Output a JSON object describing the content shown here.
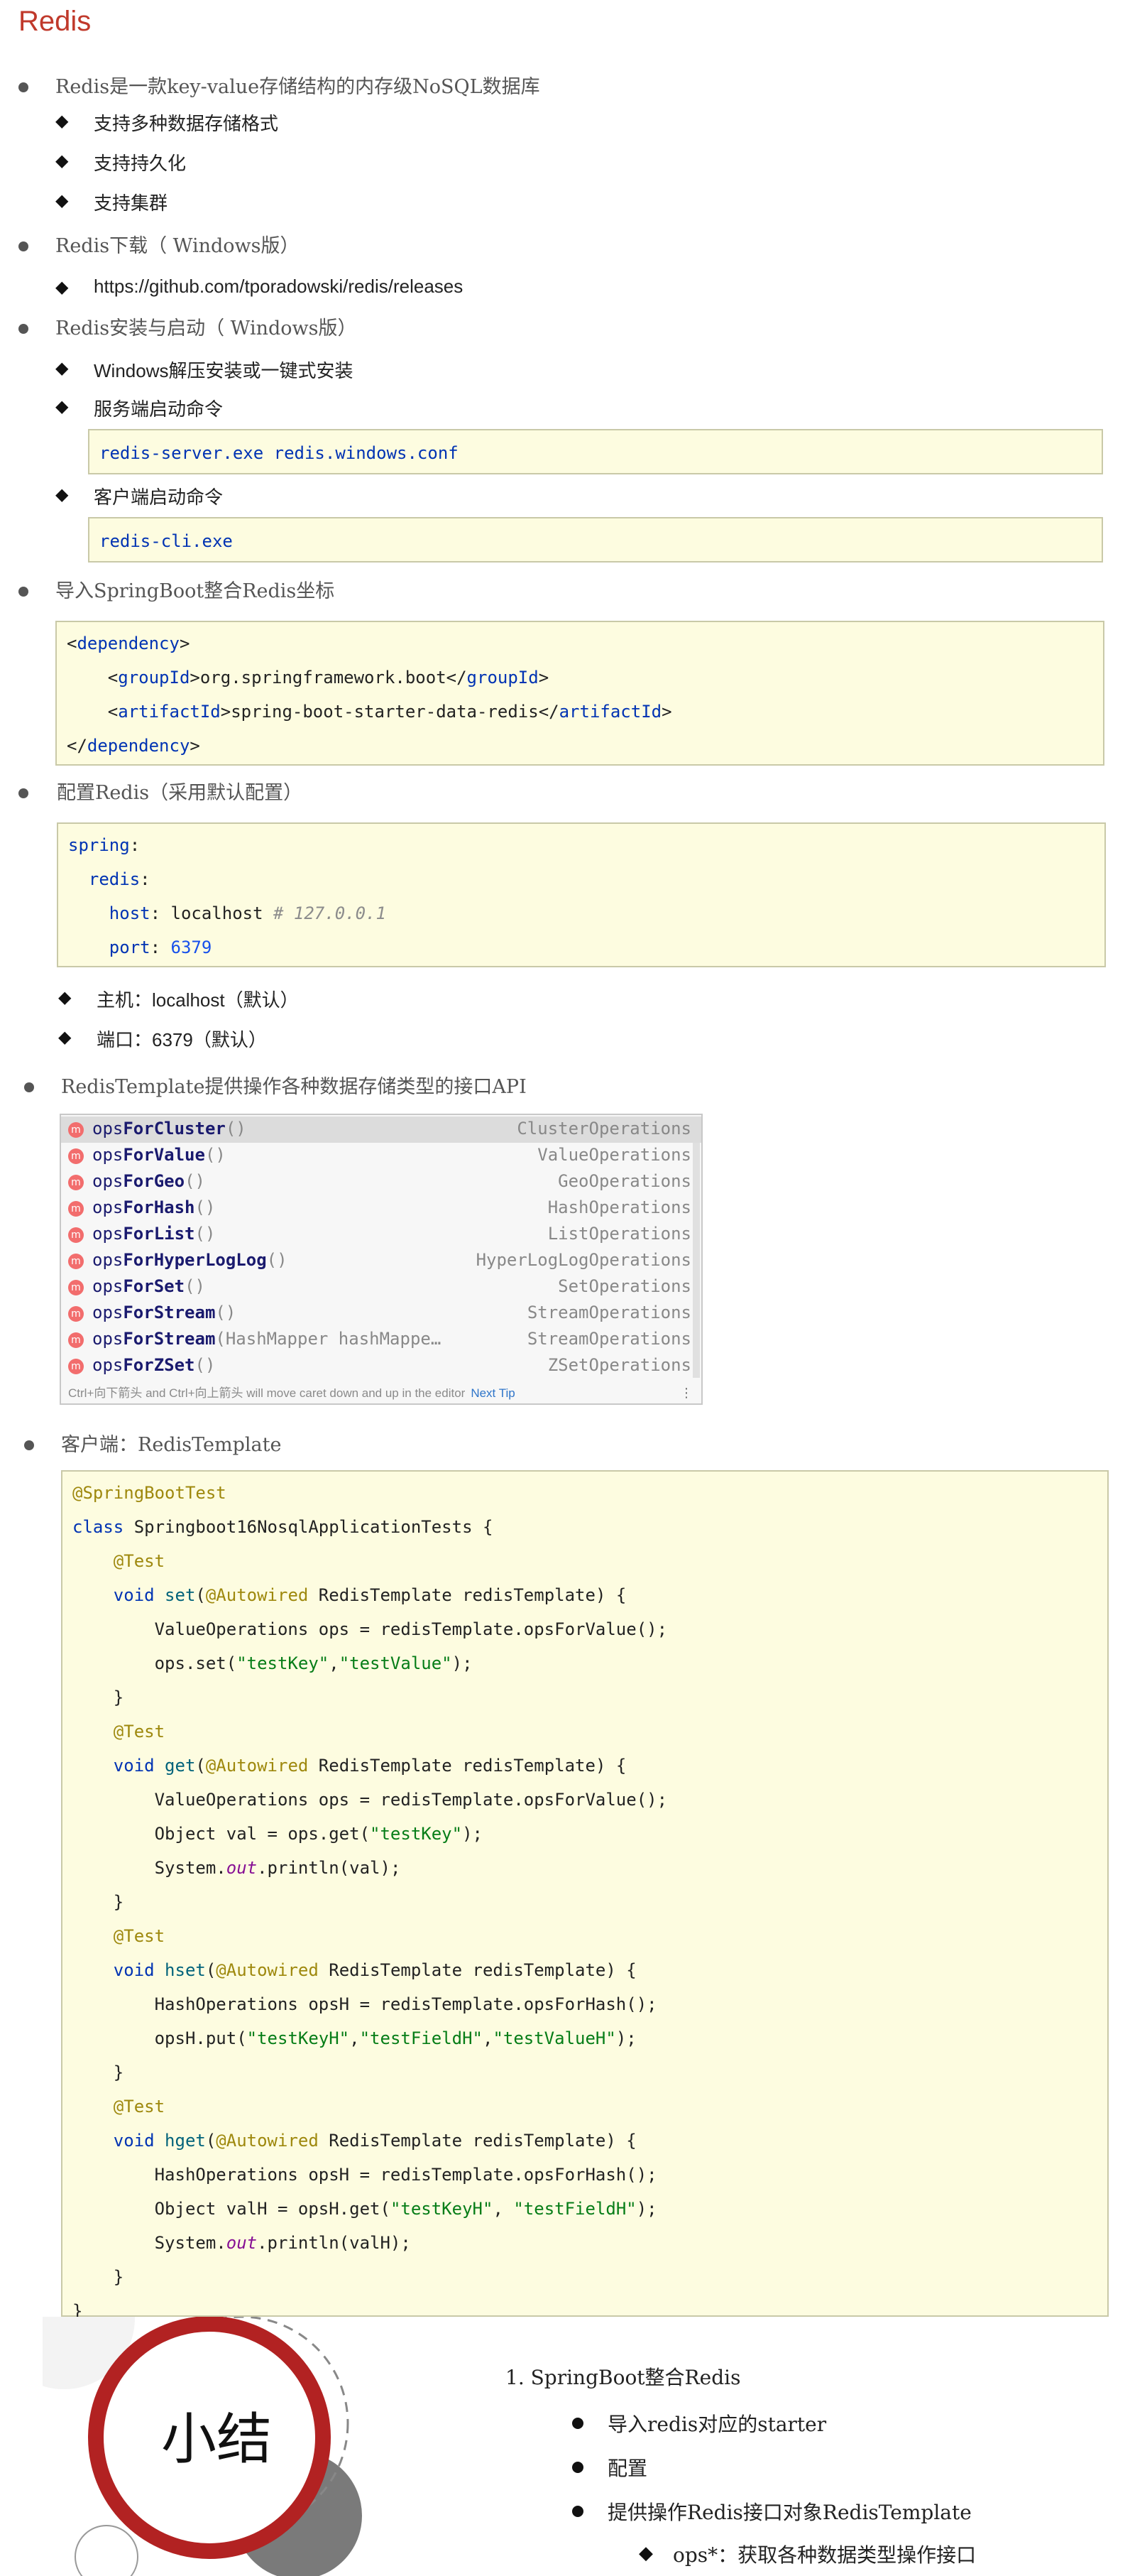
{
  "title": "Redis",
  "sections": {
    "intro": {
      "heading": "Redis是一款key-value存储结构的内存级NoSQL数据库",
      "items": [
        "支持多种数据存储格式",
        "支持持久化",
        "支持集群"
      ]
    },
    "download": {
      "heading": "Redis下载（ Windows版）",
      "items": [
        "https://github.com/tporadowski/redis/releases"
      ]
    },
    "install": {
      "heading": "Redis安装与启动（ Windows版）",
      "items": [
        "Windows解压安装或一键式安装",
        "服务端启动命令",
        "客户端启动命令"
      ],
      "server_cmd": "redis-server.exe redis.windows.conf",
      "client_cmd": "redis-cli.exe"
    },
    "dependency": {
      "heading": "导入SpringBoot整合Redis坐标",
      "group_id": "org.springframework.boot",
      "artifact_id": "spring-boot-starter-data-redis",
      "tag_dependency": "dependency",
      "tag_group": "groupId",
      "tag_artifact": "artifactId"
    },
    "config": {
      "heading": "配置Redis（采用默认配置）",
      "yaml_spring": "spring",
      "yaml_redis": "redis",
      "yaml_host_key": "host",
      "yaml_host_val": "localhost",
      "yaml_host_comment": "# 127.0.0.1",
      "yaml_port_key": "port",
      "yaml_port_val": "6379",
      "items": [
        "主机：localhost（默认）",
        "端口：6379（默认）"
      ]
    },
    "api": {
      "heading": "RedisTemplate提供操作各种数据存储类型的接口API",
      "completions": [
        {
          "pre": "ops",
          "bold": "ForCluster",
          "params": "()",
          "type": "ClusterOperations"
        },
        {
          "pre": "ops",
          "bold": "ForValue",
          "params": "()",
          "type": "ValueOperations"
        },
        {
          "pre": "ops",
          "bold": "ForGeo",
          "params": "()",
          "type": "GeoOperations"
        },
        {
          "pre": "ops",
          "bold": "ForHash",
          "params": "()",
          "type": "HashOperations"
        },
        {
          "pre": "ops",
          "bold": "ForList",
          "params": "()",
          "type": "ListOperations"
        },
        {
          "pre": "ops",
          "bold": "ForHyperLogLog",
          "params": "()",
          "type": "HyperLogLogOperations"
        },
        {
          "pre": "ops",
          "bold": "ForSet",
          "params": "()",
          "type": "SetOperations"
        },
        {
          "pre": "ops",
          "bold": "ForStream",
          "params": "()",
          "type": "StreamOperations"
        },
        {
          "pre": "ops",
          "bold": "ForStream",
          "params": "(HashMapper hashMappe…",
          "type": "StreamOperations"
        },
        {
          "pre": "ops",
          "bold": "ForZSet",
          "params": "()",
          "type": "ZSetOperations"
        }
      ],
      "footer_hint": "Ctrl+向下箭头 and Ctrl+向上箭头 will move caret down and up in the editor",
      "footer_link": "Next Tip",
      "method_icon": "m"
    },
    "client": {
      "heading": "客户端：RedisTemplate"
    }
  },
  "summary": {
    "badge": "小结",
    "title": "1. SpringBoot整合Redis",
    "items": [
      "导入redis对应的starter",
      "配置",
      "提供操作Redis接口对象RedisTemplate"
    ],
    "subitem": "ops*：获取各种数据类型操作接口",
    "ring_color": "#b22222"
  },
  "colors": {
    "title": "#c0392b",
    "code_bg": "#fdfce0"
  }
}
